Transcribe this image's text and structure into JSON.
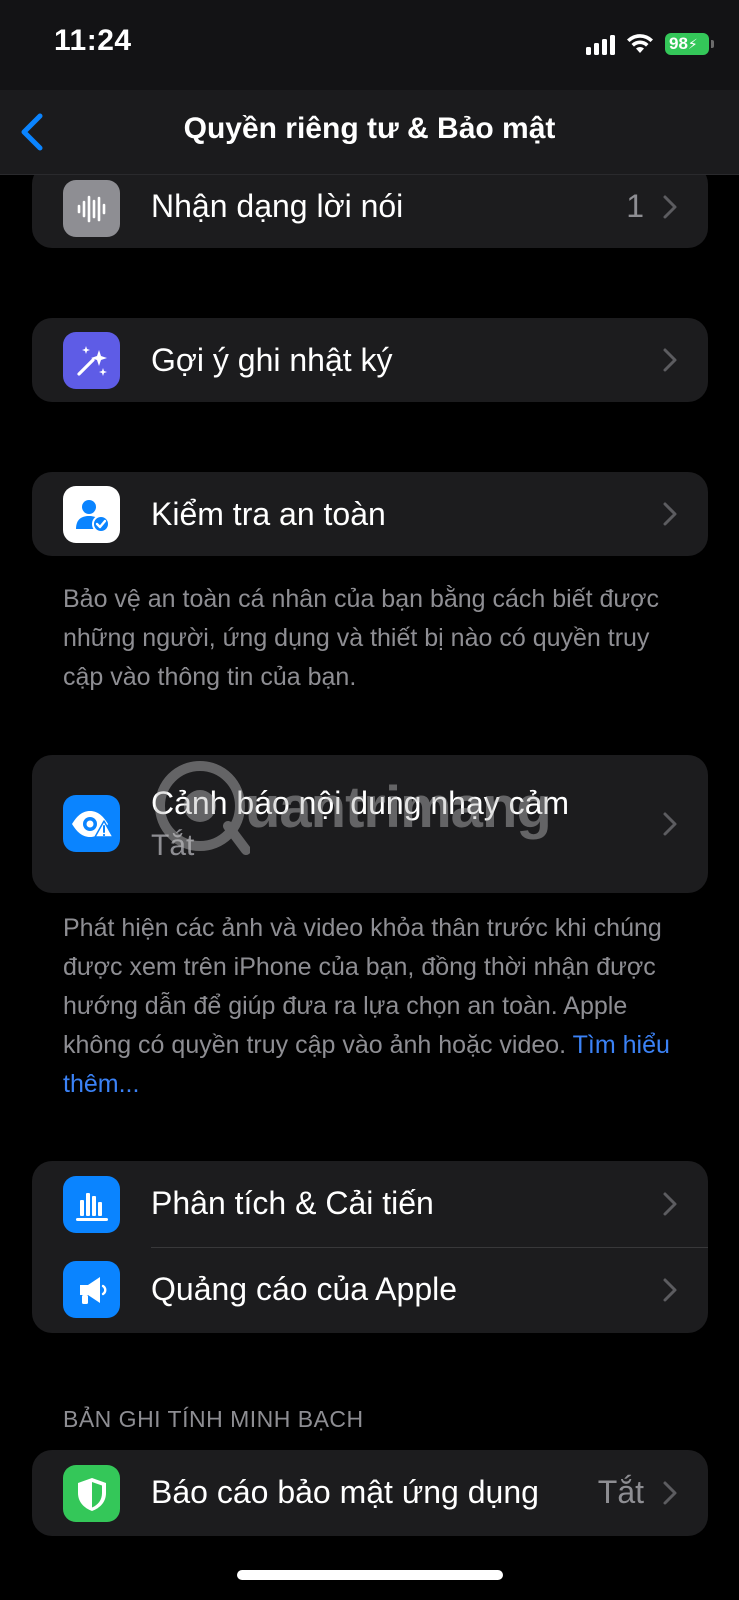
{
  "status_bar": {
    "time": "11:24",
    "battery": "98"
  },
  "nav": {
    "title": "Quyền riêng tư & Bảo mật"
  },
  "groups": {
    "speech": {
      "label": "Nhận dạng lời nói",
      "value": "1",
      "icon": "waveform-icon",
      "icon_bg": "#8e8e93"
    },
    "journal": {
      "label": "Gợi ý ghi nhật ký",
      "icon": "sparkles-icon",
      "icon_bg": "#5e5ce6"
    },
    "safety": {
      "label": "Kiểm tra an toàn",
      "icon": "person-check-icon",
      "icon_bg": "#ffffff",
      "footer": "Bảo vệ an toàn cá nhân của bạn bằng cách biết được những người, ứng dụng và thiết bị nào có quyền truy cập vào thông tin của bạn."
    },
    "sensitive": {
      "label": "Cảnh báo nội dung nhạy cảm",
      "value": "Tắt",
      "icon": "eye-warning-icon",
      "icon_bg": "#0a84ff",
      "footer": "Phát hiện các ảnh và video khỏa thân trước khi chúng được xem trên iPhone của bạn, đồng thời nhận được hướng dẫn để giúp đưa ra lựa chọn an toàn. Apple không có quyền truy cập vào ảnh hoặc video.",
      "footer_link": "Tìm hiểu thêm..."
    },
    "analytics": {
      "label": "Phân tích & Cải tiến",
      "icon": "bar-chart-icon",
      "icon_bg": "#0a84ff"
    },
    "ads": {
      "label": "Quảng cáo của Apple",
      "icon": "megaphone-icon",
      "icon_bg": "#0a84ff"
    }
  },
  "transparency": {
    "header": "BẢN GHI TÍNH MINH BẠCH",
    "label": "Báo cáo bảo mật ứng dụng",
    "value": "Tắt",
    "icon": "shield-icon",
    "icon_bg": "#34c759"
  },
  "watermark": {
    "text": "uantrimang"
  },
  "colors": {
    "background": "#000000",
    "cell": "#1c1c1e",
    "secondary_text": "#8e8e93",
    "link": "#3b82f6",
    "accent": "#0a84ff"
  }
}
